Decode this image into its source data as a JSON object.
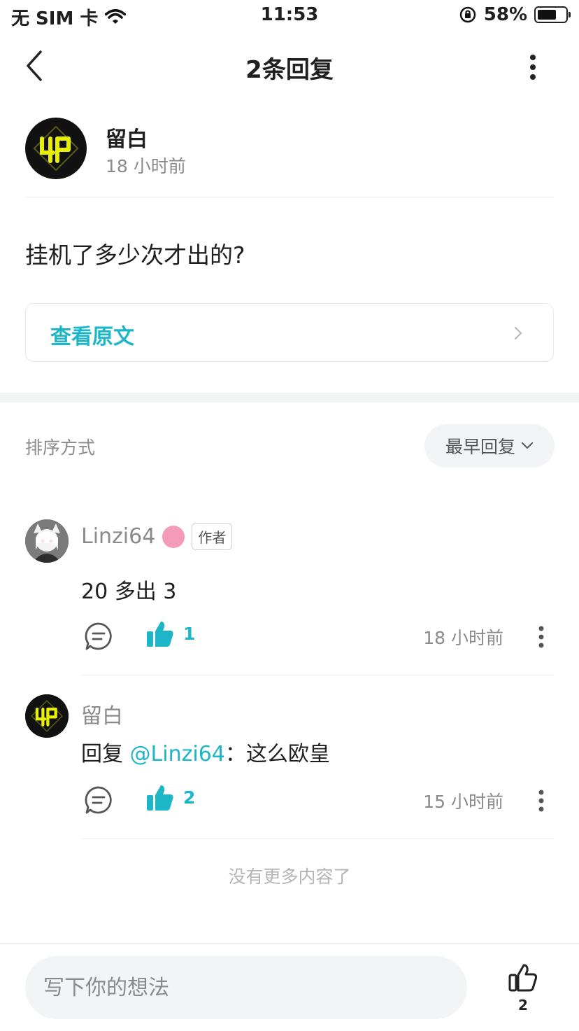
{
  "status_bar": {
    "carrier": "无 SIM 卡",
    "time": "11:53",
    "battery": "58%",
    "battery_level": 0.58
  },
  "nav": {
    "title": "2条回复"
  },
  "op": {
    "name": "留白",
    "time": "18 小时前",
    "content": "挂机了多少次才出的?"
  },
  "view_original": {
    "label": "查看原文"
  },
  "sort": {
    "label": "排序方式",
    "selected": "最早回复"
  },
  "replies": [
    {
      "name": "Linzi64",
      "author_tag": "作者",
      "text": "20 多出 3",
      "likes": "1",
      "time": "18 小时前"
    },
    {
      "name": "留白",
      "reply_prefix": "回复 ",
      "mention": "@Linzi64",
      "reply_suffix": "：这么欧皇",
      "likes": "2",
      "time": "15 小时前"
    }
  ],
  "end_text": "没有更多内容了",
  "bottom": {
    "placeholder": "写下你的想法",
    "like_count": "2"
  },
  "colors": {
    "accent": "#1cb6c8",
    "logo_yellow": "#e8f000"
  }
}
